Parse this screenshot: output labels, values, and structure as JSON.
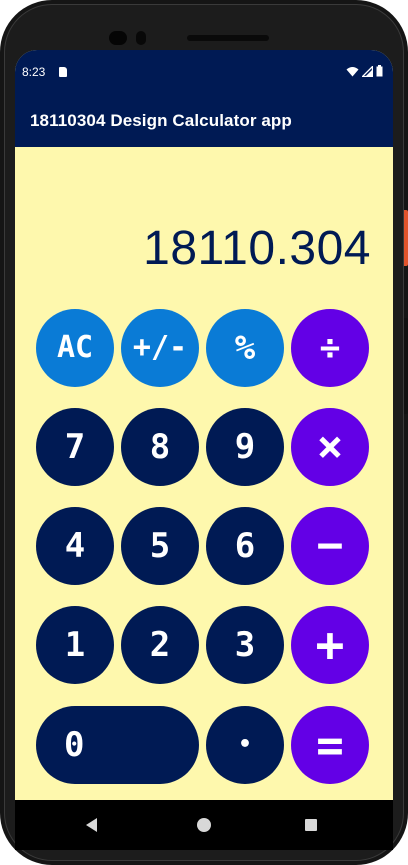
{
  "status_bar": {
    "time": "8:23",
    "icons": [
      "sd-card-icon",
      "wifi-icon",
      "signal-icon",
      "battery-icon"
    ]
  },
  "app_bar": {
    "title": "18110304 Design Calculator app"
  },
  "display": {
    "value": "18110.304"
  },
  "keys": {
    "clear": "AC",
    "plus_minus": "+/-",
    "percent": "%",
    "divide": "÷",
    "seven": "7",
    "eight": "8",
    "nine": "9",
    "multiply": "×",
    "four": "4",
    "five": "5",
    "six": "6",
    "subtract": "−",
    "one": "1",
    "two": "2",
    "three": "3",
    "add": "+",
    "zero": "0",
    "decimal": "•",
    "equals": "="
  },
  "colors": {
    "app_bar": "#001a54",
    "background": "#fef8ad",
    "digit_key": "#001a54",
    "function_key": "#0a7bd6",
    "operator_key": "#6300e6",
    "key_text": "#ffffff"
  },
  "nav_bar": {
    "buttons": [
      "back-icon",
      "home-icon",
      "recents-icon"
    ]
  }
}
